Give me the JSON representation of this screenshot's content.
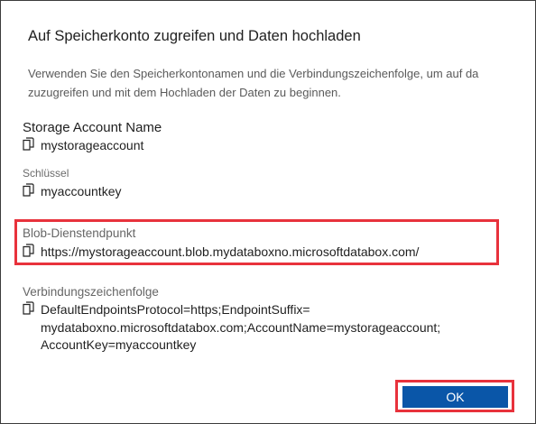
{
  "dialog": {
    "title": "Auf Speicherkonto zugreifen und Daten hochladen",
    "description_line1": "Verwenden Sie den Speicherkontonamen und die Verbindungszeichenfolge, um auf da",
    "description_line2": "zuzugreifen und mit dem Hochladen der Daten zu beginnen."
  },
  "fields": {
    "storage_account": {
      "label": "Storage Account Name",
      "value": "mystorageaccount",
      "icon": "copy-icon"
    },
    "key": {
      "label": "Schlüssel",
      "value": "myaccountkey",
      "icon": "copy-icon"
    },
    "blob_endpoint": {
      "label": "Blob-Dienstendpunkt",
      "value": "https://mystorageaccount.blob.mydataboxno.microsoftdatabox.com/",
      "icon": "copy-icon"
    },
    "connection_string": {
      "label": "Verbindungszeichenfolge",
      "line1": "DefaultEndpointsProtocol=https;EndpointSuffix=",
      "line2": "mydataboxno.microsoftdatabox.com;AccountName=mystorageaccount;",
      "line3": "AccountKey=myaccountkey",
      "icon": "copy-icon"
    }
  },
  "buttons": {
    "ok_label": "OK"
  },
  "colors": {
    "highlight": "#e8323c",
    "ok_button": "#0a56a8"
  }
}
